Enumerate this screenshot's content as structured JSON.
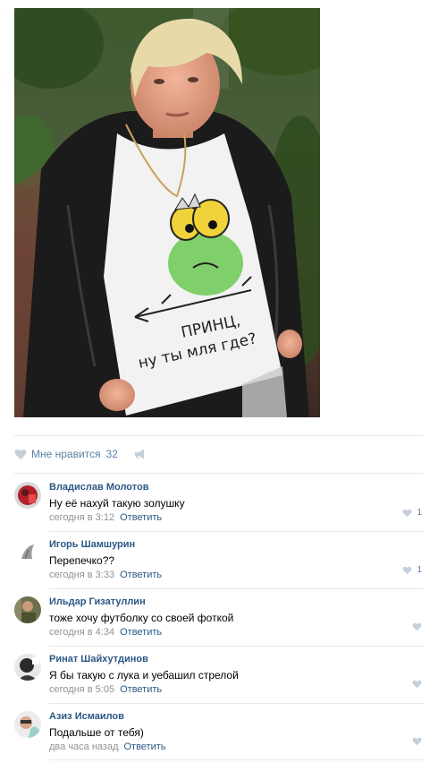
{
  "post": {
    "photo_shirt_text_line1": "ПРИНЦ,",
    "photo_shirt_text_line2": "ну ты мля где?"
  },
  "likes": {
    "label": "Мне нравится",
    "count": "32"
  },
  "colors": {
    "link": "#2a5885",
    "meta": "#939393",
    "divider": "#e7e8ec",
    "heart": "#c5d0db"
  },
  "comments": [
    {
      "author": "Владислав Молотов",
      "text": "Ну её нахуй такую золушку",
      "time": "сегодня в 3:12",
      "reply": "Ответить",
      "likes": "1"
    },
    {
      "author": "Игорь Шамшурин",
      "text": "Перепечко??",
      "time": "сегодня в 3:33",
      "reply": "Ответить",
      "likes": "1"
    },
    {
      "author": "Ильдар Гизатуллин",
      "text": "тоже хочу футболку со своей фоткой",
      "time": "сегодня в 4:34",
      "reply": "Ответить",
      "likes": ""
    },
    {
      "author": "Ринат Шайхутдинов",
      "text": "Я бы такую с лука и уебашил стрелой",
      "time": "сегодня в 5:05",
      "reply": "Ответить",
      "likes": ""
    },
    {
      "author": "Азиз Исмаилов",
      "text": "Подальше от тебя)",
      "time": "два часа назад",
      "reply": "Ответить",
      "likes": ""
    }
  ]
}
